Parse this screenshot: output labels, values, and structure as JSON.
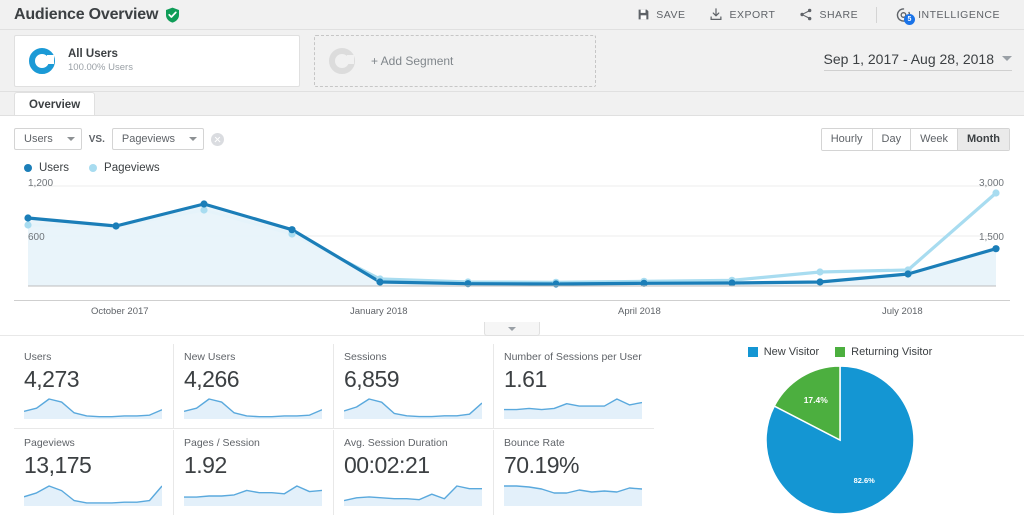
{
  "header": {
    "title": "Audience Overview",
    "verified_icon": "verified-shield-icon",
    "actions": [
      {
        "icon": "save-icon",
        "label": "SAVE"
      },
      {
        "icon": "export-icon",
        "label": "EXPORT"
      },
      {
        "icon": "share-icon",
        "label": "SHARE"
      }
    ],
    "intelligence": {
      "icon": "intelligence-icon",
      "label": "INTELLIGENCE",
      "badge": "5"
    }
  },
  "segments": {
    "all_users": {
      "name": "All Users",
      "sub": "100.00% Users",
      "icon": "segment-donut-icon"
    },
    "add_segment": {
      "label": "+ Add Segment",
      "icon": "add-segment-donut-icon"
    },
    "date_range": {
      "value": "Sep 1, 2017 - Aug 28, 2018",
      "icon": "chevron-down-icon"
    }
  },
  "tabs": [
    {
      "label": "Overview",
      "active": true
    }
  ],
  "controls": {
    "metric_primary": "Users",
    "vs_label": "VS.",
    "metric_secondary": "Pageviews",
    "remove_icon": "close-circle-icon",
    "granularity": [
      "Hourly",
      "Day",
      "Week",
      "Month"
    ],
    "granularity_selected": "Month"
  },
  "colors": {
    "users_blue": "#1b7eb8",
    "pageviews_light": "#a8dcf0",
    "area_fill": "#e8f3fa",
    "pie_blue": "#1496d3",
    "pie_green": "#4caf3f",
    "accent": "#1b9ad6"
  },
  "chart_data": {
    "type": "line",
    "title": "",
    "xlabel": "",
    "ylabel": "Users",
    "grid": true,
    "legend_position": "top-left",
    "legend": [
      "Users",
      "Pageviews"
    ],
    "x": [
      "September 2017",
      "October 2017",
      "November 2017",
      "December 2017",
      "January 2018",
      "February 2018",
      "March 2018",
      "April 2018",
      "May 2018",
      "June 2018",
      "July 2018",
      "August 2018"
    ],
    "xtick_labels": [
      "October 2017",
      "January 2018",
      "April 2018",
      "July 2018"
    ],
    "y_left_ticks": [
      "600",
      "1,200"
    ],
    "y_right_ticks": [
      "1,500",
      "3,000"
    ],
    "ylim_left": [
      0,
      1500
    ],
    "ylim_right": [
      0,
      3000
    ],
    "series": [
      {
        "name": "Users",
        "axis": "left",
        "color": "#1b7eb8",
        "values": [
          1020,
          900,
          1230,
          845,
          60,
          35,
          30,
          40,
          45,
          60,
          180,
          560
        ]
      },
      {
        "name": "Pageviews",
        "axis": "right",
        "color": "#a8dcf0",
        "values": [
          1830,
          1800,
          2280,
          1560,
          210,
          120,
          110,
          140,
          170,
          420,
          480,
          2790
        ]
      }
    ]
  },
  "metrics": [
    {
      "label": "Users",
      "value": "4,273",
      "spark": "users-sparkline"
    },
    {
      "label": "New Users",
      "value": "4,266",
      "spark": "new-users-sparkline"
    },
    {
      "label": "Sessions",
      "value": "6,859",
      "spark": "sessions-sparkline"
    },
    {
      "label": "Number of Sessions per User",
      "value": "1.61",
      "spark": "sessions-per-user-sparkline"
    },
    {
      "label": "Pageviews",
      "value": "13,175",
      "spark": "pageviews-sparkline"
    },
    {
      "label": "Pages / Session",
      "value": "1.92",
      "spark": "pages-per-session-sparkline"
    },
    {
      "label": "Avg. Session Duration",
      "value": "00:02:21",
      "spark": "avg-duration-sparkline"
    },
    {
      "label": "Bounce Rate",
      "value": "70.19%",
      "spark": "bounce-rate-sparkline"
    }
  ],
  "pie_chart": {
    "type": "pie",
    "title": "",
    "legend_position": "top",
    "legend": [
      "New Visitor",
      "Returning Visitor"
    ],
    "categories": [
      "New Visitor",
      "Returning Visitor"
    ],
    "values": [
      82.6,
      17.4
    ],
    "labels": [
      "82.6%",
      "17.4%"
    ],
    "colors": [
      "#1496d3",
      "#4caf3f"
    ]
  },
  "expander": {
    "icon": "chevron-down-icon"
  }
}
